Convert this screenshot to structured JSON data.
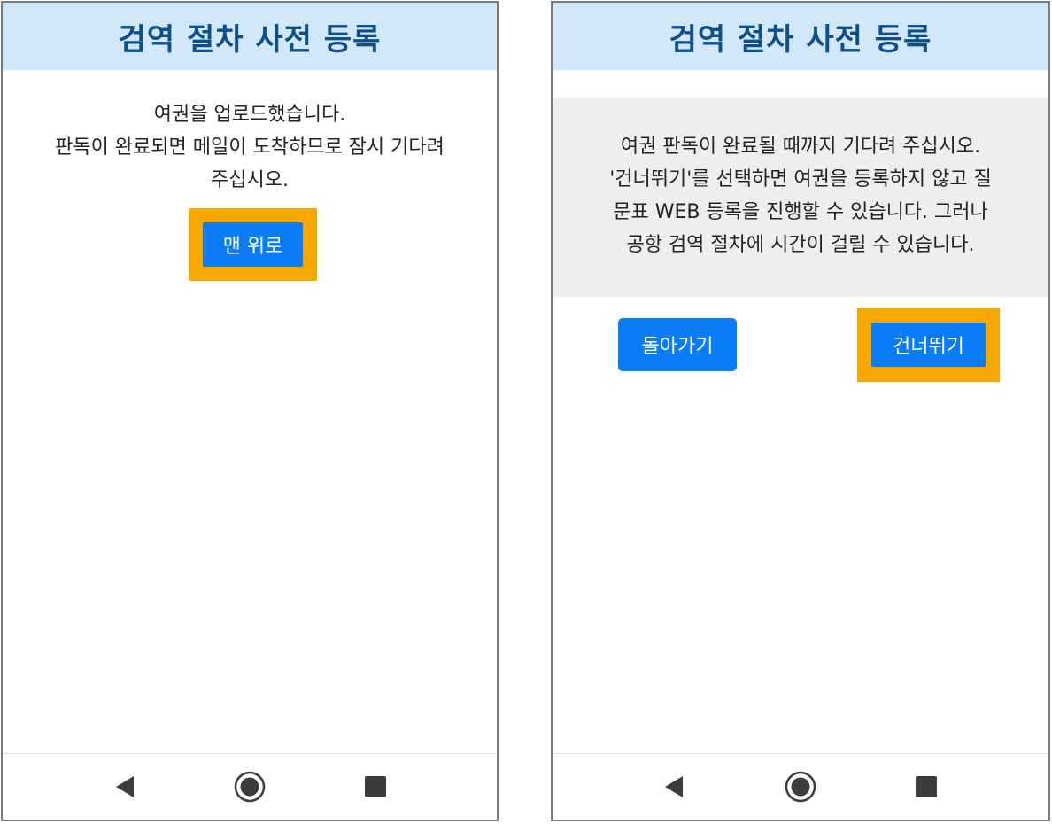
{
  "left_screen": {
    "header": {
      "title": "검역 절차 사전 등록"
    },
    "message": {
      "line1": "여권을 업로드했습니다.",
      "line2": "판독이 완료되면 메일이 도착하므로 잠시 기다려",
      "line3": "주십시오."
    },
    "top_button_label": "맨 위로"
  },
  "right_screen": {
    "header": {
      "title": "검역 절차 사전 등록"
    },
    "message": {
      "line1": "여권 판독이 완료될 때까지 기다려 주십시오.",
      "line2": "'건너뛰기'를 선택하면 여권을 등록하지 않고 질",
      "line3": "문표 WEB 등록을 진행할 수 있습니다. 그러나",
      "line4": "공항 검역 절차에 시간이 걸릴 수 있습니다."
    },
    "back_button_label": "돌아가기",
    "skip_button_label": "건너뛰기"
  },
  "navigation_bar": {
    "icons": [
      "back-triangle-icon",
      "home-circle-icon",
      "recents-square-icon"
    ]
  },
  "colors": {
    "header_bg": "#d2e7f8",
    "header_text": "#0d4f8b",
    "button_bg": "#0a7cf5",
    "highlight": "#f6a800",
    "info_box_bg": "#eeeeee"
  }
}
